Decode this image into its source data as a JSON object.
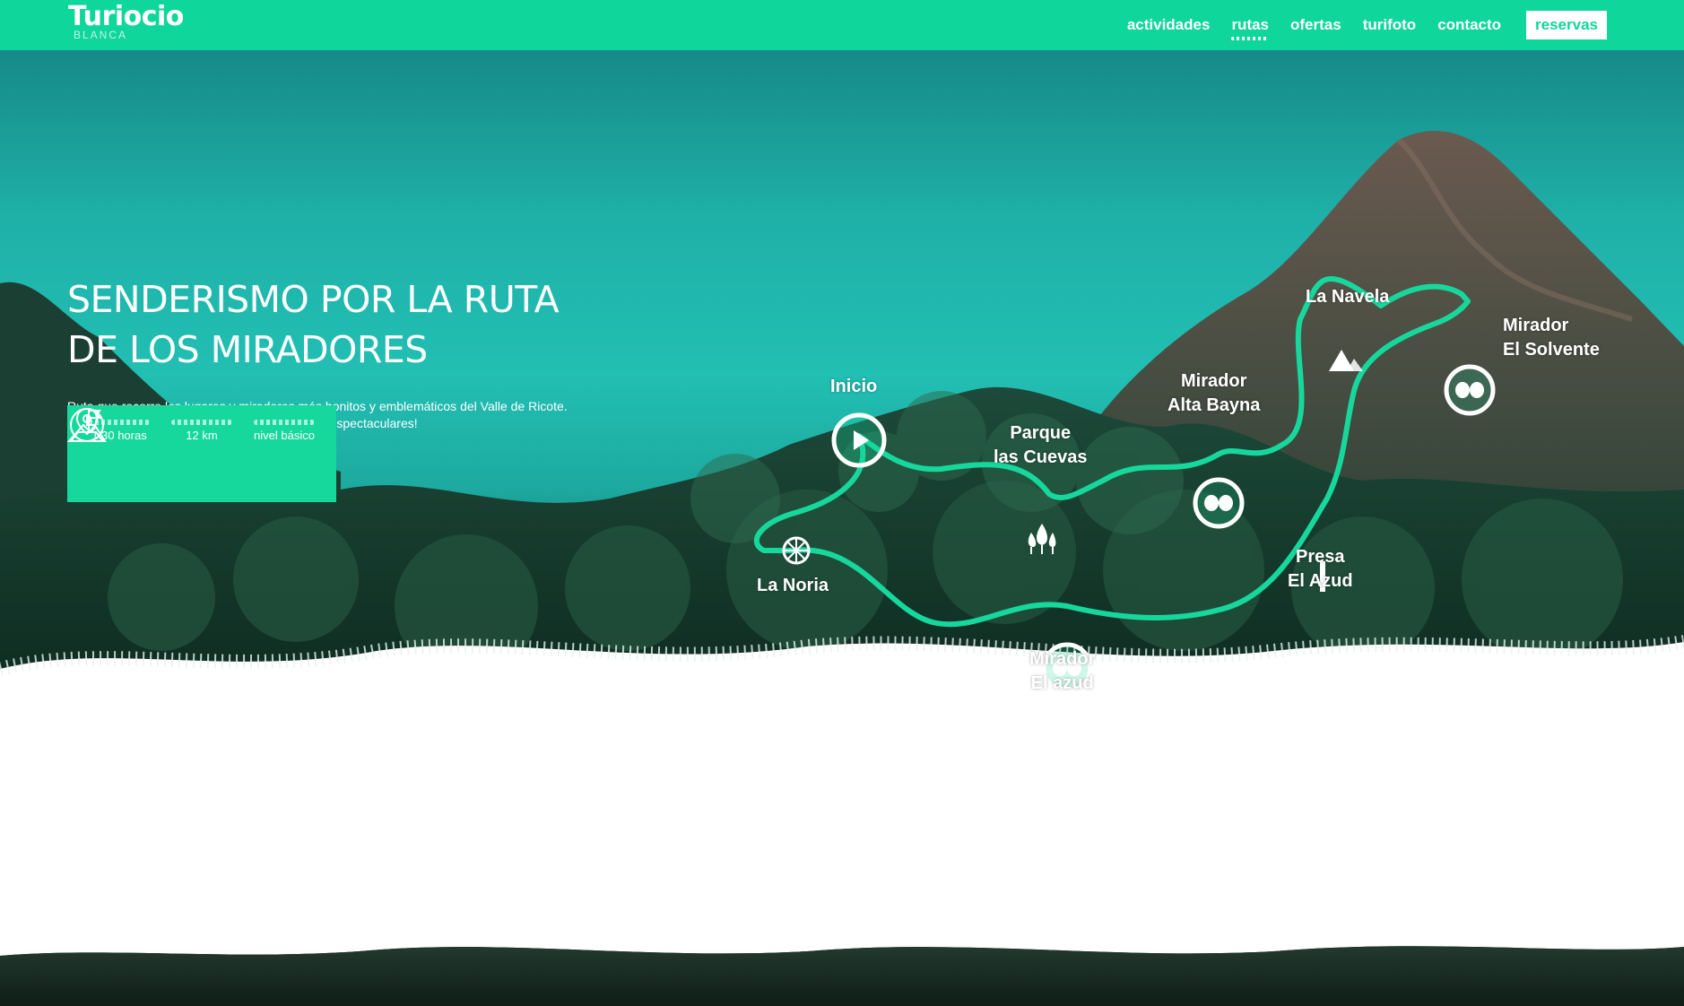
{
  "brand": {
    "name": "Turiocio",
    "sub": "BLANCA"
  },
  "nav": {
    "items": [
      "actividades",
      "rutas",
      "ofertas",
      "turifoto",
      "contacto"
    ],
    "active": "rutas",
    "cta": "reservas"
  },
  "hero": {
    "title_line1": "SENDERISMO POR LA RUTA",
    "title_line2": "DE LOS MIRADORES",
    "description": "Ruta que recorre los lugares y miradores más bonitos y emblemáticos del Valle de Ricote. Descubre los paisajes de Blanca y Cieza, ¡son espectaculares!"
  },
  "stats": [
    {
      "icon": "clock-icon",
      "label": "1:30 horas"
    },
    {
      "icon": "map-pin-icon",
      "label": "12 km"
    },
    {
      "icon": "mountain-flag-icon",
      "label": "nivel básico"
    }
  ],
  "route": {
    "color": "#17d89c",
    "stops": [
      {
        "key": "inicio",
        "lines": [
          "Inicio"
        ],
        "icon": "play-icon"
      },
      {
        "key": "noria",
        "lines": [
          "La Noria"
        ],
        "icon": "wheel-icon"
      },
      {
        "key": "cuevas",
        "lines": [
          "Parque",
          "las Cuevas"
        ],
        "icon": "trees-icon"
      },
      {
        "key": "altabayna",
        "lines": [
          "Mirador",
          "Alta Bayna"
        ],
        "icon": "binoculars-icon"
      },
      {
        "key": "navela",
        "lines": [
          "La Navela"
        ],
        "icon": "mountain-icon"
      },
      {
        "key": "solvente",
        "lines": [
          "Mirador",
          "El Solvente"
        ],
        "icon": "binoculars-icon"
      },
      {
        "key": "presa",
        "lines": [
          "Presa",
          "El Azud"
        ],
        "icon": "dam-icon"
      },
      {
        "key": "azud",
        "lines": [
          "Mirador",
          "El azud"
        ],
        "icon": "binoculars-icon"
      }
    ]
  }
}
